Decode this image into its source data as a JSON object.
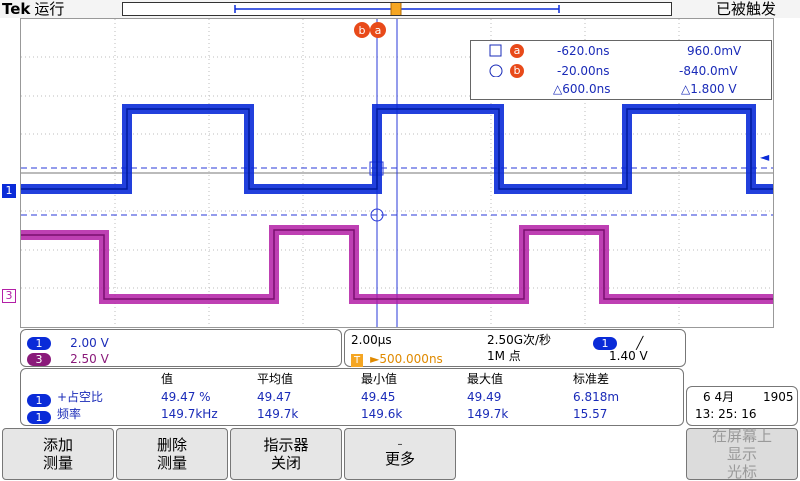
{
  "header": {
    "brand": "Tek",
    "run_status": "运行",
    "trigger_status": "已被触发"
  },
  "channels": {
    "ch1_marker": "1",
    "ch3_marker": "3",
    "ch1_color": "#0a2bd8",
    "ch3_color": "#b31fa6"
  },
  "cursor_readout": {
    "a_label": "a",
    "b_label": "b",
    "a_time": "-620.0ns",
    "a_volt": "960.0mV",
    "b_time": "-20.00ns",
    "b_volt": "-840.0mV",
    "delta_time": "△600.0ns",
    "delta_volt": "△1.800 V"
  },
  "vertical": {
    "ch1_badge": "1",
    "ch1_scale": "2.00 V",
    "ch3_badge": "3",
    "ch3_scale": "2.50 V"
  },
  "horizontal": {
    "timebase": "2.00µs",
    "sample_rate": "2.50G次/秒",
    "trigger_source": "1",
    "trigger_slope": "╱",
    "trigger_pos_marker": "T",
    "trigger_position": "►500.000ns",
    "record_length": "1M 点",
    "trigger_level": "1.40 V"
  },
  "measurements": {
    "headers": [
      "值",
      "平均值",
      "最小值",
      "最大值",
      "标准差"
    ],
    "rows": [
      {
        "badge": "1",
        "name": "+占空比",
        "value": "49.47 %",
        "mean": "49.47",
        "min": "49.45",
        "max": "49.49",
        "std": "6.818m"
      },
      {
        "badge": "1",
        "name": "频率",
        "value": "149.7kHz",
        "mean": "149.7k",
        "min": "149.6k",
        "max": "149.7k",
        "std": "15.57"
      }
    ]
  },
  "datetime": {
    "date": "6 4月",
    "year": "1905",
    "time": "13: 25: 16"
  },
  "softkeys": [
    {
      "line1": "添加",
      "line2": "测量"
    },
    {
      "line1": "删除",
      "line2": "测量"
    },
    {
      "line1": "指示器",
      "line2": "关闭"
    },
    {
      "line1": "–",
      "line2": "更多"
    },
    {
      "line1": "在屏幕上",
      "line2": "显示",
      "line3": "光标"
    }
  ]
}
